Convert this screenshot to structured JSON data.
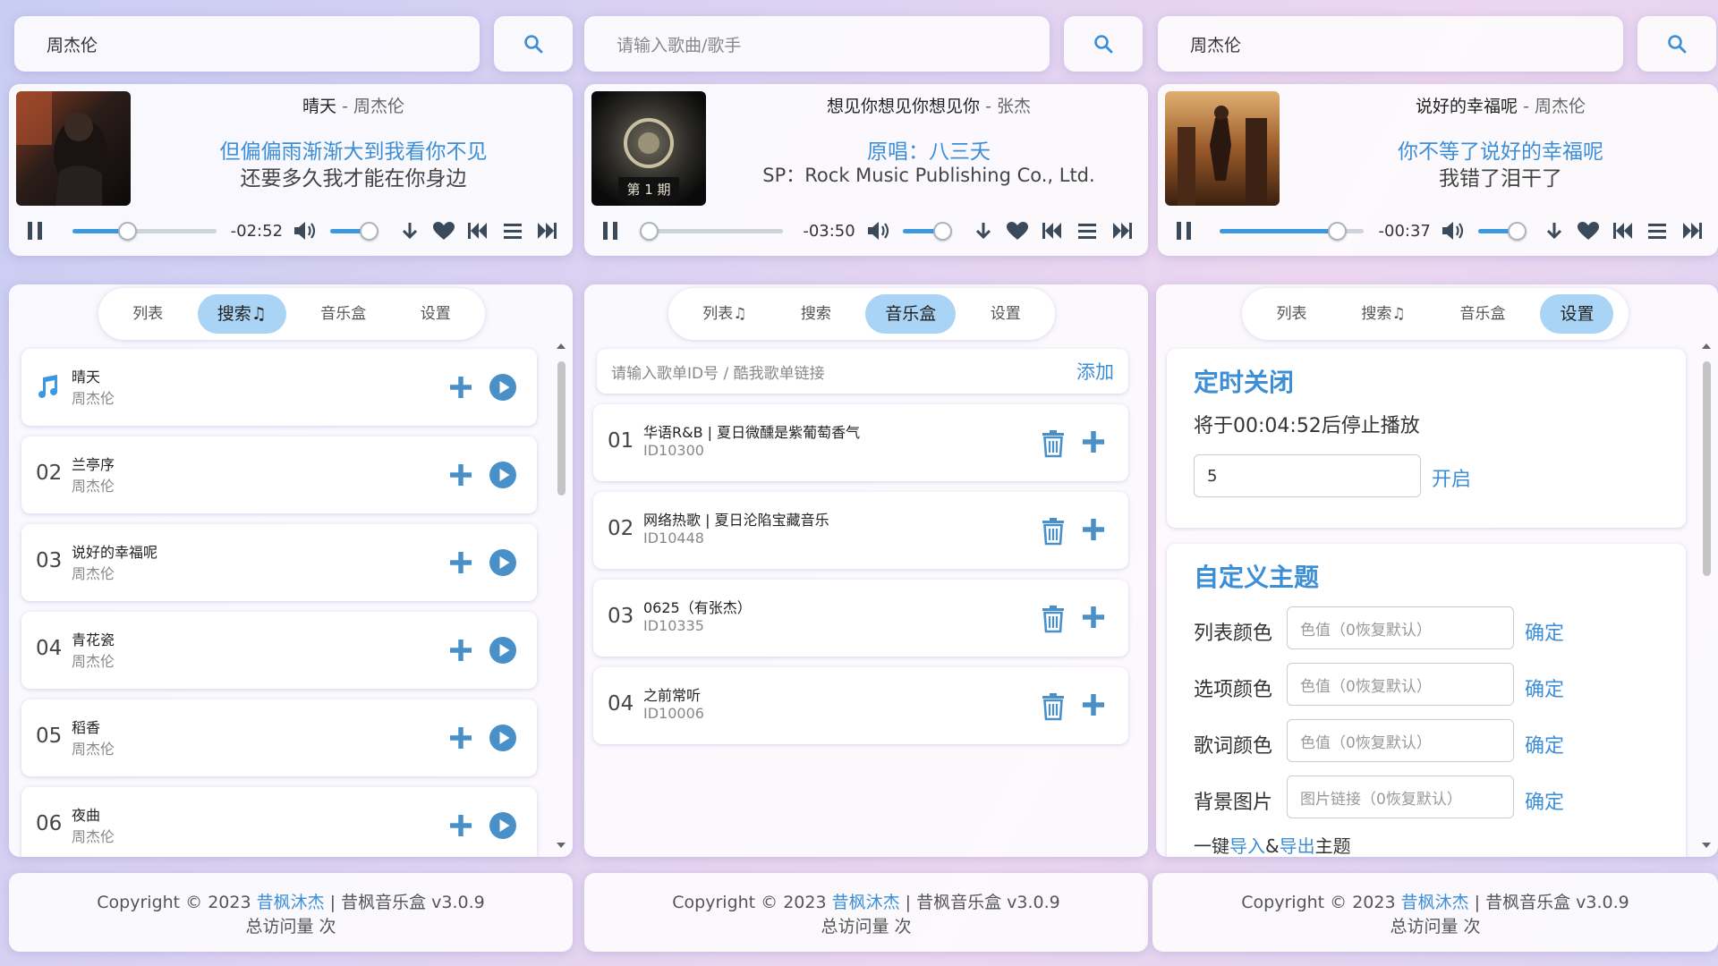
{
  "colors": {
    "accent": "#3c8fd6",
    "tab_active": "#a9d4f5",
    "icon": "#3a4a5a",
    "action": "#4a90c8"
  },
  "columns": [
    {
      "search": {
        "value": "周杰伦",
        "placeholder": ""
      },
      "player": {
        "song": "晴天",
        "sep": " - ",
        "artist": "周杰伦",
        "lyric1": "但偏偏雨渐渐大到我看你不见",
        "lyric2": "还要多久我才能在你身边",
        "time": "-02:52",
        "progress": 0.38,
        "volume": 0.8
      },
      "tabs": [
        {
          "label": "列表"
        },
        {
          "label": "搜索♫"
        },
        {
          "label": "音乐盒"
        },
        {
          "label": "设置"
        }
      ],
      "active_tab": 1,
      "songs": [
        {
          "num": "",
          "title": "晴天",
          "artist": "周杰伦",
          "playing": true
        },
        {
          "num": "02",
          "title": "兰亭序",
          "artist": "周杰伦"
        },
        {
          "num": "03",
          "title": "说好的幸福呢",
          "artist": "周杰伦"
        },
        {
          "num": "04",
          "title": "青花瓷",
          "artist": "周杰伦"
        },
        {
          "num": "05",
          "title": "稻香",
          "artist": "周杰伦"
        },
        {
          "num": "06",
          "title": "夜曲",
          "artist": "周杰伦"
        }
      ]
    },
    {
      "search": {
        "value": "",
        "placeholder": "请输入歌曲/歌手"
      },
      "player": {
        "song": "想见你想见你想见你",
        "sep": " - ",
        "artist": "张杰",
        "lyric1": "原唱：八三夭",
        "lyric2": "SP：Rock Music Publishing Co., Ltd.",
        "time": "-03:50",
        "progress": 0.03,
        "volume": 0.8,
        "cover_text": "第 1 期"
      },
      "tabs": [
        {
          "label": "列表♫"
        },
        {
          "label": "搜索"
        },
        {
          "label": "音乐盒"
        },
        {
          "label": "设置"
        }
      ],
      "active_tab": 2,
      "playlist_input": {
        "placeholder": "请输入歌单ID号 / 酷我歌单链接",
        "button": "添加"
      },
      "playlists": [
        {
          "num": "01",
          "title": "华语R&B | 夏日微醺是紫葡萄香气",
          "id": "ID10300"
        },
        {
          "num": "02",
          "title": "网络热歌 | 夏日沦陷宝藏音乐",
          "id": "ID10448"
        },
        {
          "num": "03",
          "title": "0625（有张杰）",
          "id": "ID10335"
        },
        {
          "num": "04",
          "title": "之前常听",
          "id": "ID10006"
        }
      ]
    },
    {
      "search": {
        "value": "周杰伦",
        "placeholder": ""
      },
      "player": {
        "song": "说好的幸福呢",
        "sep": " - ",
        "artist": "周杰伦",
        "lyric1": "你不等了说好的幸福呢",
        "lyric2": "我错了泪干了",
        "time": "-00:37",
        "progress": 0.81,
        "volume": 0.8
      },
      "tabs": [
        {
          "label": "列表"
        },
        {
          "label": "搜索♫"
        },
        {
          "label": "音乐盒"
        },
        {
          "label": "设置"
        }
      ],
      "active_tab": 3,
      "timer": {
        "title": "定时关闭",
        "status": "将于00:04:52后停止播放",
        "value": "5",
        "button": "开启"
      },
      "theme": {
        "title": "自定义主题",
        "rows": [
          {
            "label": "列表颜色",
            "placeholder": "色值（0恢复默认）",
            "button": "确定"
          },
          {
            "label": "选项颜色",
            "placeholder": "色值（0恢复默认）",
            "button": "确定"
          },
          {
            "label": "歌词颜色",
            "placeholder": "色值（0恢复默认）",
            "button": "确定"
          },
          {
            "label": "背景图片",
            "placeholder": "图片链接（0恢复默认）",
            "button": "确定"
          }
        ],
        "oneclick_prefix": "一键",
        "import": "导入",
        "amp": "&",
        "export": "导出",
        "suffix": "主题"
      }
    }
  ],
  "footer": {
    "prefix": "Copyright © 2023 ",
    "author": "昔枫沐杰",
    "suffix": " | 昔枫音乐盒 v3.0.9",
    "visits": "总访问量 次"
  }
}
